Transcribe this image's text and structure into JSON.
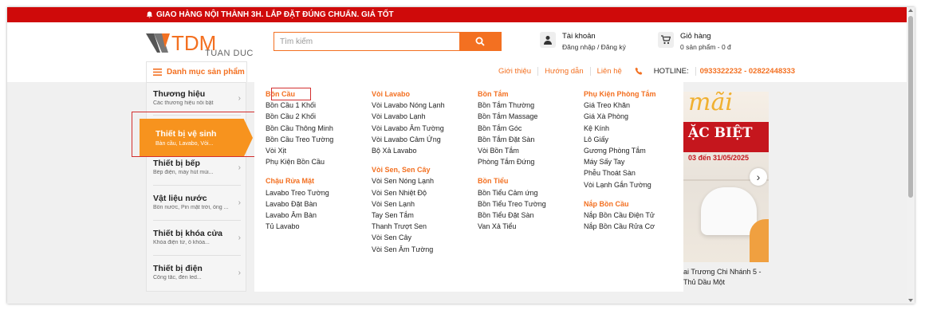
{
  "topbar": {
    "text": "GIAO HÀNG NỘI THÀNH 3H. LẮP ĐẶT ĐÚNG CHUẨN. GIÁ TỐT"
  },
  "logo": {
    "main": "TDM",
    "sub": "TUAN DUC"
  },
  "search": {
    "placeholder": "Tìm kiếm"
  },
  "account": {
    "title": "Tài khoản",
    "sub": "Đăng nhập / Đăng ký"
  },
  "cart": {
    "title": "Giỏ hàng",
    "sub": "0 sản phẩm - 0 đ"
  },
  "nav": {
    "category_label": "Danh mục sản phẩm",
    "links": [
      "Giới thiệu",
      "Hướng dẫn",
      "Liên hệ"
    ],
    "hotline_label": "HOTLINE:",
    "hotline_numbers": "0933322232 - 02822448333"
  },
  "sidebar": {
    "items": [
      {
        "title": "Thương hiệu",
        "sub": "Các thương hiệu nổi bật"
      },
      {
        "title": "Thiết bị vệ sinh",
        "sub": "Bàn cầu, Lavabo, Vòi..."
      },
      {
        "title": "Thiết bị bếp",
        "sub": "Bếp điện, máy hút mùi..."
      },
      {
        "title": "Vật liệu nước",
        "sub": "Bồn nước, Pin mặt trời, ống ..."
      },
      {
        "title": "Thiết bị khóa cửa",
        "sub": "Khóa điện tử, ổ khóa..."
      },
      {
        "title": "Thiết bị điện",
        "sub": "Công tắc, đèn led..."
      }
    ]
  },
  "mega": {
    "col1": {
      "g1_title": "Bồn Cầu",
      "g1_items": [
        "Bồn Cầu 1 Khối",
        "Bồn Cầu 2 Khối",
        "Bồn Cầu Thông Minh",
        "Bồn Cầu Treo Tường",
        "Vòi Xịt",
        "Phụ Kiện Bồn Cầu"
      ],
      "g2_title": "Chậu Rửa Mặt",
      "g2_items": [
        "Lavabo Treo Tường",
        "Lavabo Đặt Bàn",
        "Lavabo Âm Bàn",
        "Tủ Lavabo"
      ]
    },
    "col2": {
      "g1_title": "Vòi Lavabo",
      "g1_items": [
        "Vòi Lavabo Nóng Lạnh",
        "Vòi Lavabo Lạnh",
        "Vòi Lavabo Âm Tường",
        "Vòi Lavabo Cảm Ứng",
        "Bộ Xả Lavabo"
      ],
      "g2_title": "Vòi Sen, Sen Cây",
      "g2_items": [
        "Vòi Sen Nóng Lạnh",
        "Vòi Sen Nhiệt Độ",
        "Vòi Sen Lạnh",
        "Tay Sen Tắm",
        "Thanh Trượt Sen",
        "Vòi Sen Cây",
        "Vòi Sen Âm Tường"
      ]
    },
    "col3": {
      "g1_title": "Bồn Tắm",
      "g1_items": [
        "Bồn Tắm Thường",
        "Bồn Tắm Massage",
        "Bồn Tắm Góc",
        "Bồn Tắm Đặt Sàn",
        "Vòi Bồn Tắm",
        "Phòng Tắm Đứng"
      ],
      "g2_title": "Bồn Tiểu",
      "g2_items": [
        "Bồn Tiểu Cảm ứng",
        "Bồn Tiểu Treo Tường",
        "Bồn Tiểu Đặt Sàn",
        "Van Xả Tiểu"
      ]
    },
    "col4": {
      "g1_title": "Phụ Kiện Phòng Tắm",
      "g1_items": [
        "Giá Treo Khăn",
        "Giá Xà Phòng",
        "Kệ Kính",
        "Lô Giấy",
        "Gương Phòng Tắm",
        "Máy Sấy Tay",
        "Phễu Thoát Sàn",
        "Vòi Lạnh Gắn Tường"
      ],
      "g2_title": "Nắp Bồn Cầu",
      "g2_items": [
        "Nắp Bồn Cầu Điện Tử",
        "Nắp Bồn Cầu Rửa Cơ"
      ]
    }
  },
  "banner": {
    "big": "mãi",
    "line1": "ẶC BIỆT",
    "line2": "03 đến 31/05/2025",
    "caption": "ai Trương Chi Nhánh 5 - Thủ Dầu Một"
  }
}
